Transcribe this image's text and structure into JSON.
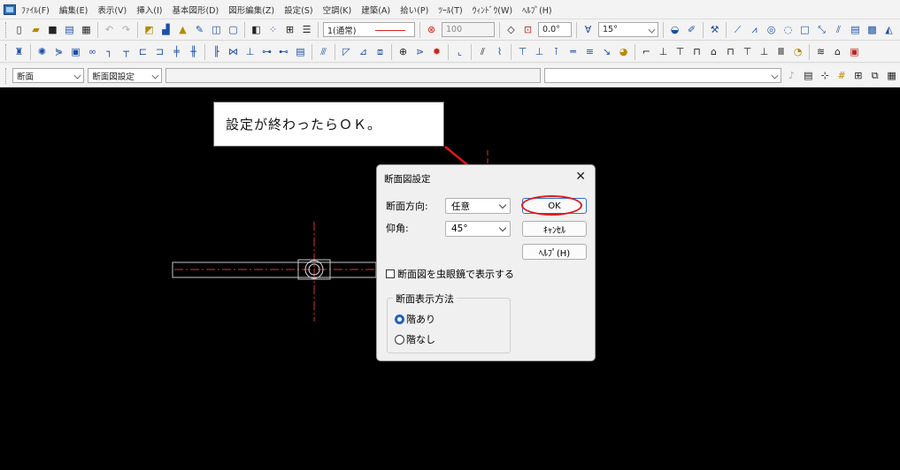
{
  "menu": [
    "ﾌｧｲﾙ(F)",
    "編集(E)",
    "表示(V)",
    "挿入(I)",
    "基本図形(D)",
    "図形編集(Z)",
    "設定(S)",
    "空調(K)",
    "建築(A)",
    "拾い(P)",
    "ﾂｰﾙ(T)",
    "ｳｨﾝﾄﾞｳ(W)",
    "ﾍﾙﾌﾟ(H)"
  ],
  "toolbar1": {
    "line_style": "1(通常)",
    "scale": "100",
    "angle": "0.0°",
    "snap_angle": "15°"
  },
  "toolbar3": {
    "view_mode": "断面",
    "section_setting": "断面図設定",
    "command_input": "",
    "message_input": ""
  },
  "callout": {
    "text": "設定が終わったらＯＫ。"
  },
  "dialog": {
    "title": "断面図設定",
    "close_glyph": "✕",
    "direction_label": "断面方向:",
    "direction_value": "任意",
    "elevation_label": "仰角:",
    "elevation_value": "45°",
    "ok_label": "OK",
    "cancel_label": "ｷｬﾝｾﾙ",
    "help_label": "ﾍﾙﾌﾟ(H)",
    "magnifier_label": "断面図を虫眼鏡で表示する",
    "magnifier_checked": false,
    "display_group_label": "断面表示方法",
    "radio_with_floor": "階あり",
    "radio_without_floor": "階なし",
    "selected_radio": "階あり"
  },
  "colors": {
    "canvas_bg": "#000000",
    "annotation_red": "#e01818",
    "centerline_red": "#e03030",
    "dialog_default_border": "#2b6fd6"
  }
}
